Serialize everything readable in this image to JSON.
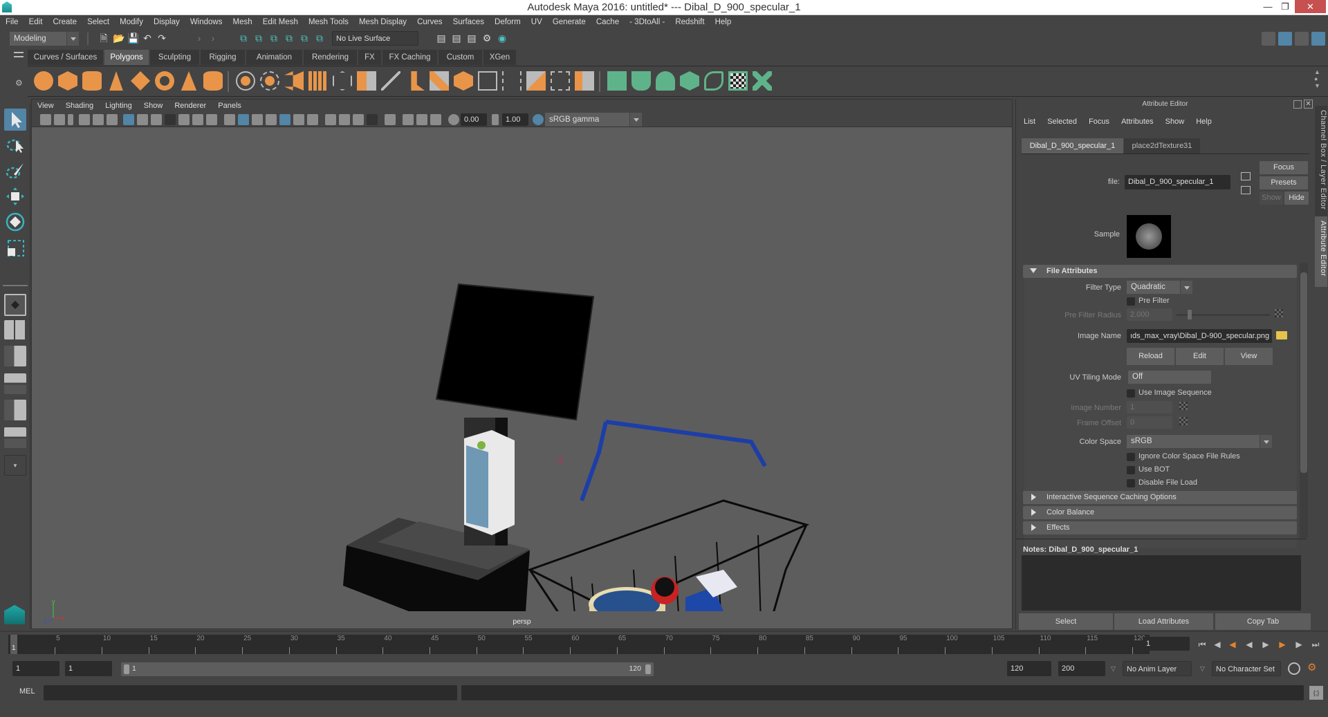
{
  "window": {
    "title": "Autodesk Maya 2016: untitled*   ---   Dibal_D_900_specular_1",
    "minimize_icon": "minimize-icon",
    "maximize_icon": "restore-icon",
    "close_icon": "close-icon"
  },
  "menubar": [
    "File",
    "Edit",
    "Create",
    "Select",
    "Modify",
    "Display",
    "Windows",
    "Mesh",
    "Edit Mesh",
    "Mesh Tools",
    "Mesh Display",
    "Curves",
    "Surfaces",
    "Deform",
    "UV",
    "Generate",
    "Cache",
    "- 3DtoAll -",
    "Redshift",
    "Help"
  ],
  "statusline": {
    "menuset": "Modeling",
    "live_surface": "No Live Surface"
  },
  "shelf": {
    "tabs": [
      "Curves / Surfaces",
      "Polygons",
      "Sculpting",
      "Rigging",
      "Animation",
      "Rendering",
      "FX",
      "FX Caching",
      "Custom",
      "XGen"
    ],
    "active_tab": "Polygons"
  },
  "viewport": {
    "menus": [
      "View",
      "Shading",
      "Lighting",
      "Show",
      "Renderer",
      "Panels"
    ],
    "exposure": "0.00",
    "gamma": "1.00",
    "color_transform": "sRGB gamma",
    "camera_label": "persp",
    "axis": {
      "x": "x",
      "y": "y",
      "z": "z"
    }
  },
  "attribute_editor": {
    "header": "Attribute Editor",
    "menus": [
      "List",
      "Selected",
      "Focus",
      "Attributes",
      "Show",
      "Help"
    ],
    "tabs": [
      "Dibal_D_900_specular_1",
      "place2dTexture31"
    ],
    "active_tab": "Dibal_D_900_specular_1",
    "node_label": "file:",
    "node_name": "Dibal_D_900_specular_1",
    "buttons": {
      "focus": "Focus",
      "presets": "Presets",
      "show": "Show",
      "hide": "Hide"
    },
    "sample_label": "Sample",
    "file_attributes": {
      "title": "File Attributes",
      "filter_type_label": "Filter Type",
      "filter_type": "Quadratic",
      "pre_filter_label": "Pre Filter",
      "pre_filter": false,
      "pre_filter_radius_label": "Pre Filter Radius",
      "pre_filter_radius": "2.000",
      "image_name_label": "Image Name",
      "image_name": "ıds_max_vray\\Dibal_D-900_specular.png",
      "reload": "Reload",
      "edit": "Edit",
      "view": "View",
      "uv_tiling_label": "UV Tiling Mode",
      "uv_tiling": "Off",
      "use_image_sequence_label": "Use Image Sequence",
      "image_number_label": "Image Number",
      "image_number": "1",
      "frame_offset_label": "Frame Offset",
      "frame_offset": "0",
      "color_space_label": "Color Space",
      "color_space": "sRGB",
      "ignore_cs_label": "Ignore Color Space File Rules",
      "use_bot_label": "Use BOT",
      "disable_file_load_label": "Disable File Load"
    },
    "collapsed_sections": [
      "Interactive Sequence Caching Options",
      "Color Balance",
      "Effects"
    ],
    "notes_label": "Notes:  Dibal_D_900_specular_1",
    "bottom_buttons": [
      "Select",
      "Load Attributes",
      "Copy Tab"
    ]
  },
  "side_tabs": [
    "Channel Box / Layer Editor",
    "Attribute Editor"
  ],
  "timeline": {
    "ticks": [
      5,
      10,
      15,
      20,
      25,
      30,
      35,
      40,
      45,
      50,
      55,
      60,
      65,
      70,
      75,
      80,
      85,
      90,
      95,
      100,
      105,
      110,
      115,
      120
    ],
    "current_frame_marker": "1",
    "current_frame": "1",
    "range_start_outer": "1",
    "range_start_inner": "1",
    "range_slider_start": "1",
    "range_slider_end": "120",
    "range_end_inner": "120",
    "range_end_outer": "200",
    "anim_layer": "No Anim Layer",
    "character_set": "No Character Set"
  },
  "command_line": {
    "language": "MEL",
    "input": "",
    "output": ""
  },
  "colors": {
    "accent_blue": "#5285a6",
    "shelf_orange": "#e8954a",
    "shelf_green": "#5fb38a",
    "close_red": "#c75050"
  }
}
